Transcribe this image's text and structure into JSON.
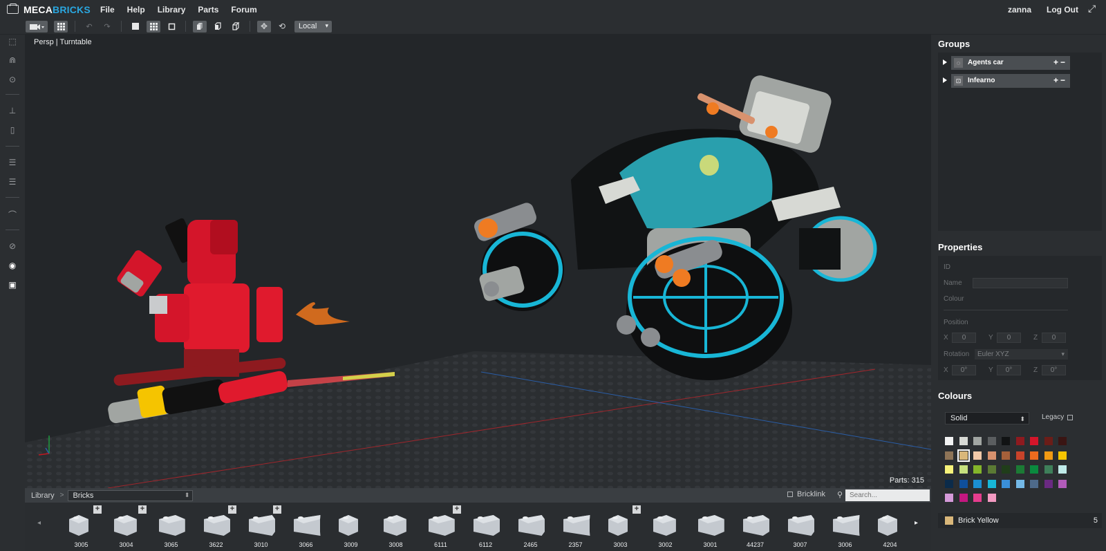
{
  "app": {
    "logo_primary": "MECA",
    "logo_secondary": "BRICKS"
  },
  "menu": {
    "items": [
      "File",
      "Help",
      "Library",
      "Parts",
      "Forum"
    ],
    "user": "zanna",
    "logout": "Log Out"
  },
  "toolbar": {
    "space_value": "Local"
  },
  "viewport": {
    "camera_label": "Persp | Turntable",
    "parts_count": "Parts: 315"
  },
  "library": {
    "breadcrumb": "Library",
    "category": "Bricks",
    "bricklink_label": "Bricklink",
    "search_placeholder": "Search...",
    "bricks": [
      {
        "id": "3005",
        "plus": true
      },
      {
        "id": "3004",
        "plus": true
      },
      {
        "id": "3065",
        "plus": false
      },
      {
        "id": "3622",
        "plus": true
      },
      {
        "id": "3010",
        "plus": true
      },
      {
        "id": "3066",
        "plus": false
      },
      {
        "id": "3009",
        "plus": false
      },
      {
        "id": "3008",
        "plus": false
      },
      {
        "id": "6111",
        "plus": true
      },
      {
        "id": "6112",
        "plus": false
      },
      {
        "id": "2465",
        "plus": false
      },
      {
        "id": "2357",
        "plus": false
      },
      {
        "id": "3003",
        "plus": true
      },
      {
        "id": "3002",
        "plus": false
      },
      {
        "id": "3001",
        "plus": false
      },
      {
        "id": "44237",
        "plus": false
      },
      {
        "id": "3007",
        "plus": false
      },
      {
        "id": "3006",
        "plus": false
      },
      {
        "id": "4204",
        "plus": false
      }
    ]
  },
  "groups": {
    "title": "Groups",
    "items": [
      {
        "name": "Agents car",
        "locked": false
      },
      {
        "name": "Infearno",
        "locked": true
      }
    ]
  },
  "properties": {
    "title": "Properties",
    "id_label": "ID",
    "name_label": "Name",
    "colour_label": "Colour",
    "position_label": "Position",
    "rotation_label": "Rotation",
    "rotation_mode": "Euler XYZ",
    "axis_x": "X",
    "axis_y": "Y",
    "axis_z": "Z",
    "pos_x": "0",
    "pos_y": "0",
    "pos_z": "0",
    "rot_x": "0°",
    "rot_y": "0°",
    "rot_z": "0°"
  },
  "colours": {
    "title": "Colours",
    "type": "Solid",
    "legacy_label": "Legacy",
    "selected_name": "Brick Yellow",
    "selected_count": "5",
    "selected_color": "#d9b77a",
    "swatches": [
      "#f2f3f3",
      "#d7d9d4",
      "#a1a5a2",
      "#5b5e60",
      "#111314",
      "#8e1a1f",
      "#d4152a",
      "#6b1d18",
      "#3a1513",
      "#8e7457",
      "#d9b77a",
      "#f2c9a8",
      "#d8926e",
      "#a5603a",
      "#c8432a",
      "#ef6b1e",
      "#f29a13",
      "#f5c400",
      "#f6f27a",
      "#c6e07e",
      "#84b52a",
      "#5b7a34",
      "#203d1a",
      "#1c7a35",
      "#0a8a3e",
      "#3e7f5a",
      "#bfeae8",
      "#0b2b4a",
      "#0f4f9c",
      "#1b8fd2",
      "#18b6d6",
      "#3a8fd8",
      "#73b8e6",
      "#4e6a8a",
      "#6a2a82",
      "#b25bba",
      "#d59ad9",
      "#c41780",
      "#e63d8e",
      "#f39ac2"
    ]
  }
}
